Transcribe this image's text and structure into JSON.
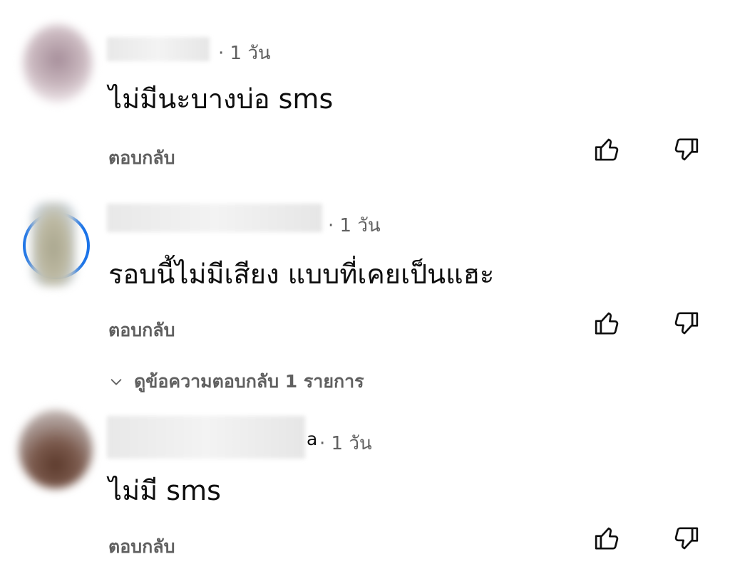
{
  "comments": [
    {
      "name_tail": "",
      "meta": "· 1 วัน",
      "text": "ไม่มีนะบางบ่อ sms",
      "reply_label": "ตอบกลับ"
    },
    {
      "name_tail": "",
      "meta": "· 1 วัน",
      "text": "รอบนี้ไม่มีเสียง แบบที่เคยเป็นแฮะ",
      "reply_label": "ตอบกลับ",
      "view_replies_label": "ดูข้อความตอบกลับ 1 รายการ"
    },
    {
      "name_tail": "a",
      "meta": "· 1 วัน",
      "text": "ไม่มี sms",
      "reply_label": "ตอบกลับ"
    }
  ],
  "icons": {
    "like": "thumbs-up-icon",
    "dislike": "thumbs-down-icon",
    "chevron": "chevron-down-icon"
  },
  "colors": {
    "primary_text": "#0f0f0f",
    "secondary_text": "#606060",
    "avatar_ring": "#1a73e8"
  }
}
